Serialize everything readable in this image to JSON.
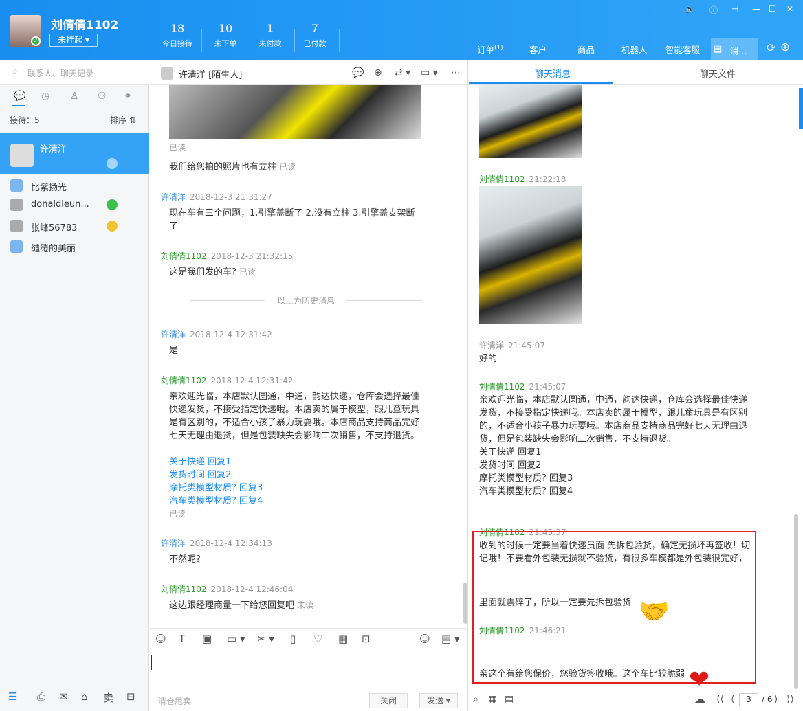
{
  "header": {
    "user_name": "刘倩倩1102",
    "status": "未挂起 ▾",
    "stats": [
      {
        "num": "18",
        "label": "今日接待"
      },
      {
        "num": "10",
        "label": "未下单"
      },
      {
        "num": "1",
        "label": "未付款"
      },
      {
        "num": "7",
        "label": "已付款"
      }
    ],
    "nav": [
      "订单",
      "客户",
      "商品",
      "机器人",
      "智能客服",
      "消..."
    ],
    "order_badge": "(1)"
  },
  "left": {
    "search_placeholder": "联系人、聊天记录",
    "receive": "接待：5",
    "sort": "排序 ⇅",
    "active_contact": "许清洋",
    "contacts": [
      {
        "name": "比紫扬光"
      },
      {
        "name": "donaldleun..."
      },
      {
        "name": "张峰56783"
      },
      {
        "name": "缱绻的美丽"
      }
    ]
  },
  "center": {
    "contact_name": "许清洋",
    "tag": "[陌生人]",
    "messages": [
      {
        "read": "已读"
      },
      {
        "text": "我们给您拍的照片也有立柱",
        "read": "已读"
      },
      {
        "sender": "许清洋",
        "time": "2018-12-3 21:31:27",
        "text": "现在车有三个问题，1.引擎盖断了 2.没有立柱 3.引擎盖支架断了"
      },
      {
        "sender": "刘倩倩1102",
        "time": "2018-12-3 21:32:15",
        "text": "这是我们发的车?",
        "read": "已读"
      },
      {
        "history": "以上为历史消息"
      },
      {
        "sender": "许清洋",
        "time": "2018-12-4 12:31:42",
        "text": "是"
      },
      {
        "sender": "刘倩倩1102",
        "time": "2018-12-4 12:31:42",
        "text": "亲欢迎光临，本店默认圆通，中通，韵达快递，仓库会选择最佳快递发货，不接受指定快递哦。本店卖的属于模型，跟儿童玩具是有区别的，不适合小孩子暴力玩耍哦。本店商品支持商品完好七天无理由退货，但是包装缺失会影响二次销售，不支持退货。",
        "links": [
          "关于快递 回复1",
          "发货时间 回复2",
          "摩托类模型材质? 回复3",
          "汽车类模型材质? 回复4"
        ],
        "read": "已读"
      },
      {
        "sender": "许清洋",
        "time": "2018-12-4 12:34:13",
        "text": "不然呢?"
      },
      {
        "sender": "刘倩倩1102",
        "time": "2018-12-4 12:46:04",
        "text": "这边跟经理商量一下给您回复吧",
        "read": "未读"
      }
    ],
    "quick_phrase": "清仓甩卖",
    "close_btn": "关闭",
    "send_btn": "发送 ▾"
  },
  "right": {
    "tabs": [
      "聊天消息",
      "聊天文件"
    ],
    "messages": [
      {
        "sender": "刘倩倩1102",
        "time": "21:22:18"
      },
      {
        "sender": "许清洋",
        "time": "21:45:07",
        "text": "好的"
      },
      {
        "sender": "刘倩倩1102",
        "time": "21:45:07",
        "text": "亲欢迎光临，本店默认圆通，中通，韵达快递，仓库会选择最佳快递发货，不接受指定快递哦。本店卖的属于模型，跟儿童玩具是有区别的，不适合小孩子暴力玩耍哦。本店商品支持商品完好七天无理由退货，但是包装缺失会影响二次销售，不支持退货。",
        "links": [
          "关于快递 回复1",
          "发货时间 回复2",
          "摩托类模型材质? 回复3",
          "汽车类模型材质? 回复4"
        ]
      },
      {
        "sender": "刘倩倩1102",
        "time": "21:45:37",
        "text": "收到的时候一定要当着快递员面 先拆包验货，确定无损坏再签收！切记哦！不要看外包装无损就不验货，有很多车模都是外包装很完好，",
        "text2": "里面就震碎了，所以一定要先拆包验货"
      },
      {
        "sender": "刘倩倩1102",
        "time": "21:46:21",
        "text": "亲这个有给您保价，您验货签收哦。这个车比较脆弱"
      }
    ],
    "page_current": "3",
    "page_total": "/ 6"
  },
  "colors": {
    "primary": "#1a8ef0",
    "sender_staff": "#2e9a2e",
    "sender_customer": "#3a8ed8",
    "highlight_box": "#e02020"
  }
}
